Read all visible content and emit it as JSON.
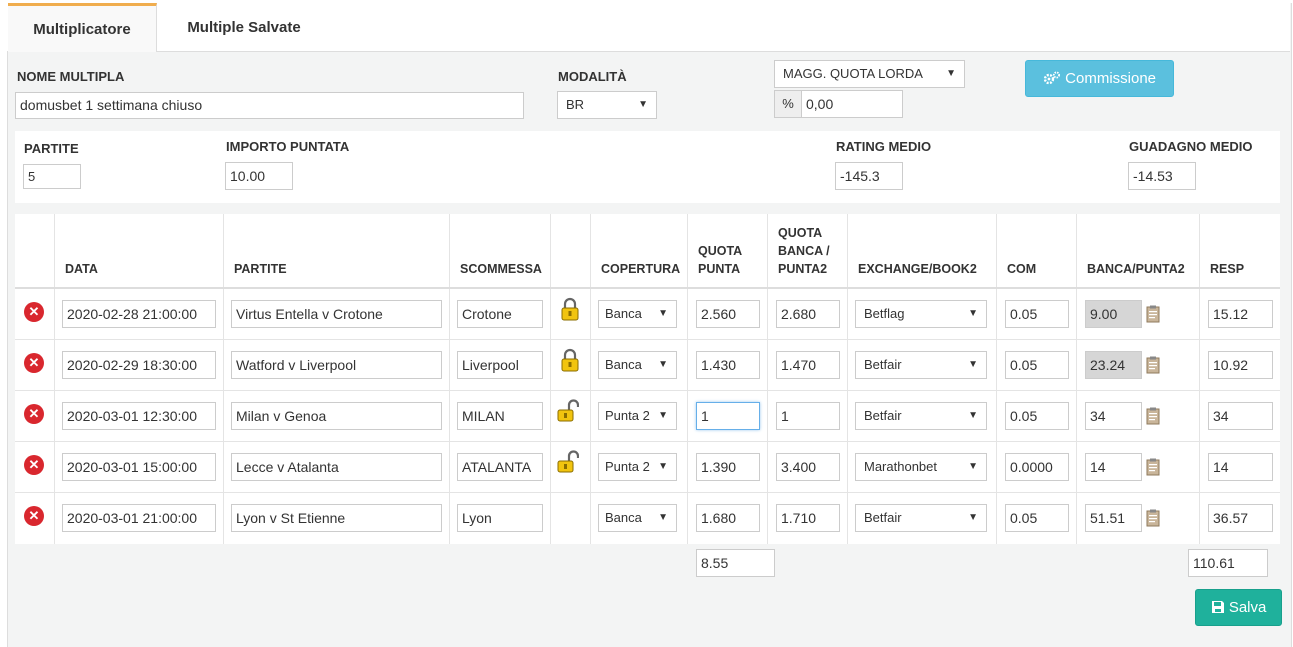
{
  "tabs": {
    "active": "Multiplicatore",
    "second": "Multiple Salvate"
  },
  "form": {
    "nome_label": "NOME MULTIPLA",
    "nome_value": "domusbet 1 settimana chiuso",
    "modalita_label": "MODALITÀ",
    "modalita_value": "BR",
    "magg_value": "MAGG. QUOTA LORDA",
    "pct_symbol": "%",
    "pct_value": "0,00",
    "commissione_label": "Commissione"
  },
  "summary": {
    "partite_label": "PARTITE",
    "partite_value": "5",
    "importo_label": "IMPORTO PUNTATA",
    "importo_value": "10.00",
    "rating_label": "RATING MEDIO",
    "rating_value": "-145.3",
    "guadagno_label": "GUADAGNO MEDIO",
    "guadagno_value": "-14.53"
  },
  "table": {
    "headers": {
      "data": "DATA",
      "partite": "PARTITE",
      "scommessa": "SCOMMESSA",
      "copertura": "COPERTURA",
      "quota_punta_1": "QUOTA",
      "quota_punta_2": "PUNTA",
      "quota_banca_1": "QUOTA",
      "quota_banca_2": "BANCA /",
      "quota_banca_3": "PUNTA2",
      "exchange": "EXCHANGE/BOOK2",
      "com": "COM",
      "banca_punta2": "BANCA/PUNTA2",
      "resp": "RESP"
    },
    "rows": [
      {
        "data": "2020-02-28 21:00:00",
        "partita": "Virtus Entella v Crotone",
        "scommessa": "Crotone",
        "lock": "locked",
        "copertura": "Banca",
        "quota_punta": "2.560",
        "quota_banca": "2.680",
        "exchange": "Betflag",
        "com": "0.05",
        "banca": "9.00",
        "banca_gray": true,
        "resp": "15.12"
      },
      {
        "data": "2020-02-29 18:30:00",
        "partita": "Watford v Liverpool",
        "scommessa": "Liverpool",
        "lock": "locked",
        "copertura": "Banca",
        "quota_punta": "1.430",
        "quota_banca": "1.470",
        "exchange": "Betfair",
        "com": "0.05",
        "banca": "23.24",
        "banca_gray": true,
        "resp": "10.92"
      },
      {
        "data": "2020-03-01 12:30:00",
        "partita": "Milan v Genoa",
        "scommessa": "MILAN",
        "lock": "unlocked",
        "copertura": "Punta 2",
        "quota_punta": "1",
        "quota_banca": "1",
        "exchange": "Betfair",
        "com": "0.05",
        "banca": "34",
        "banca_gray": false,
        "resp": "34"
      },
      {
        "data": "2020-03-01 15:00:00",
        "partita": "Lecce v Atalanta",
        "scommessa": "ATALANTA",
        "lock": "unlocked",
        "copertura": "Punta 2",
        "quota_punta": "1.390",
        "quota_banca": "3.400",
        "exchange": "Marathonbet",
        "com": "0.0000",
        "banca": "14",
        "banca_gray": false,
        "resp": "14"
      },
      {
        "data": "2020-03-01 21:00:00",
        "partita": "Lyon v St Etienne",
        "scommessa": "Lyon",
        "lock": "none",
        "copertura": "Banca",
        "quota_punta": "1.680",
        "quota_banca": "1.710",
        "exchange": "Betfair",
        "com": "0.05",
        "banca": "51.51",
        "banca_gray": false,
        "resp": "36.57"
      }
    ],
    "total_quota": "8.55",
    "total_resp": "110.61"
  },
  "save_label": "Salva",
  "colors": {
    "accent_tab": "#f0ad4e",
    "info": "#5bc0de",
    "save": "#1fb19c",
    "delete": "#d9272e"
  }
}
